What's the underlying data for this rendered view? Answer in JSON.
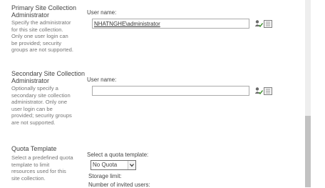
{
  "primary": {
    "title_line1": "Primary Site Collection",
    "title_line2": "Administrator",
    "desc": [
      "Specify the administrator",
      "for this site collection.",
      "Only one user login can",
      "be provided; security",
      "groups are not supported."
    ],
    "user_label": "User name:",
    "user_value": "NHATNGHE\\administrator"
  },
  "secondary": {
    "title_line1": "Secondary Site Collection",
    "title_line2": "Administrator",
    "desc": [
      "Optionally specify a",
      "secondary site collection",
      "administrator. Only one",
      "user login can be",
      "provided; security groups",
      "are not supported."
    ],
    "user_label": "User name:",
    "user_value": ""
  },
  "quota": {
    "title": "Quota Template",
    "desc": [
      "Select a predefined quota",
      "template to limit",
      "resources used for this",
      "site collection."
    ],
    "select_label": "Select a quota template:",
    "selected": "No Quota",
    "storage_label": "Storage limit:",
    "invited_label": "Number of invited users:"
  },
  "icons": {
    "check_names": "check-names-icon",
    "browse": "address-book-icon"
  }
}
